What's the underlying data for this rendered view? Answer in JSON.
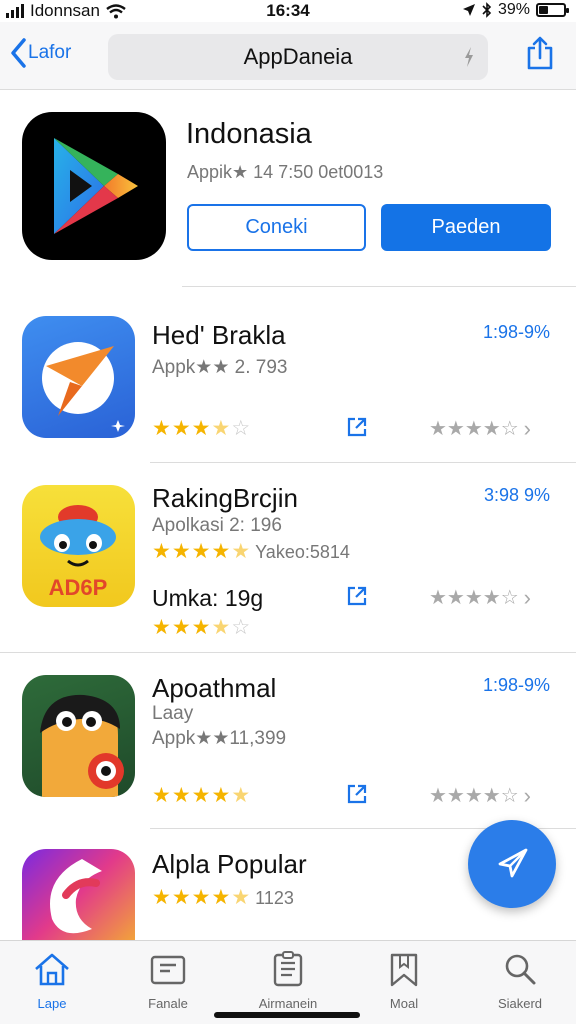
{
  "status_bar": {
    "carrier": "Idonnsan",
    "time": "16:34",
    "battery": "39%",
    "battery_level": 0.39
  },
  "nav": {
    "back_label": "Lafor",
    "search_text": "AppDaneia"
  },
  "featured": {
    "title": "Indonasia",
    "subtitle": "Appik★ 14 7:50 0et0013",
    "secondary_button": "Coneki",
    "primary_button": "Paeden"
  },
  "apps": [
    {
      "name": "Hed' Brakla",
      "meta": "Appk★★ 2. 793",
      "price": "1:98-9%",
      "rating": 3.5
    },
    {
      "name": "RakingBrcjin",
      "meta": "Apolkasi 2: 196",
      "rating_text": "Yakeo:5814",
      "price": "3:98 9%",
      "price_line": "Umka: 19g",
      "rating": 4.5,
      "rating2": 3.5
    },
    {
      "name": "Apoathmal",
      "sub": "Laay",
      "meta": "Appk★★11,399",
      "price": "1:98-9%",
      "rating": 4.5
    },
    {
      "name": "Alpla Popular",
      "rating_text": "1123",
      "rating": 4.5
    }
  ],
  "tabs": [
    {
      "label": "Lape",
      "icon": "home-icon"
    },
    {
      "label": "Fanale",
      "icon": "games-icon"
    },
    {
      "label": "Airmanein",
      "icon": "apps-icon"
    },
    {
      "label": "Moal",
      "icon": "bookmark-icon"
    },
    {
      "label": "Siakerd",
      "icon": "search-icon"
    }
  ],
  "colors": {
    "accent": "#1a73e8",
    "star": "#f5b400",
    "fab": "#2b7de9"
  }
}
